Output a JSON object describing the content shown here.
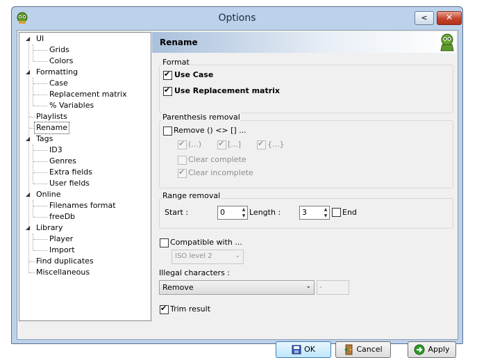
{
  "window": {
    "title": "Options",
    "back_label": "<",
    "close_label": "✕"
  },
  "tree": {
    "items": [
      {
        "label": "UI"
      },
      {
        "label": "Grids"
      },
      {
        "label": "Colors"
      },
      {
        "label": "Formatting"
      },
      {
        "label": "Case"
      },
      {
        "label": "Replacement matrix"
      },
      {
        "label": "% Variables"
      },
      {
        "label": "Playlists"
      },
      {
        "label": "Rename"
      },
      {
        "label": "Tags"
      },
      {
        "label": "ID3"
      },
      {
        "label": "Genres"
      },
      {
        "label": "Extra fields"
      },
      {
        "label": "User fields"
      },
      {
        "label": "Online"
      },
      {
        "label": "Filenames format"
      },
      {
        "label": "freeDb"
      },
      {
        "label": "Library"
      },
      {
        "label": "Player"
      },
      {
        "label": "Import"
      },
      {
        "label": "Find duplicates"
      },
      {
        "label": "Miscellaneous"
      }
    ],
    "selected": "Rename"
  },
  "panel": {
    "title": "Rename",
    "format": {
      "label": "Format",
      "use_case": "Use Case",
      "use_replacement": "Use Replacement matrix"
    },
    "parenthesis": {
      "label": "Parenthesis removal",
      "remove": "Remove () <> [] ...",
      "paren": "(...)",
      "bracket": "[...]",
      "brace": "{...}",
      "clear_complete": "Clear complete",
      "clear_incomplete": "Clear incomplete"
    },
    "range": {
      "label": "Range removal",
      "start_label": "Start :",
      "start_value": "0",
      "length_label": "Length :",
      "length_value": "3",
      "end_label": "End"
    },
    "compatible": {
      "label": "Compatible with ...",
      "value": "ISO level 2"
    },
    "illegal": {
      "label": "Illegal characters :",
      "value": "Remove",
      "replacement": "-"
    },
    "trim": "Trim result"
  },
  "buttons": {
    "ok": "OK",
    "cancel": "Cancel",
    "apply": "Apply"
  },
  "colors": {
    "accent": "#1a3a9c",
    "selection_outline": "#333333"
  }
}
